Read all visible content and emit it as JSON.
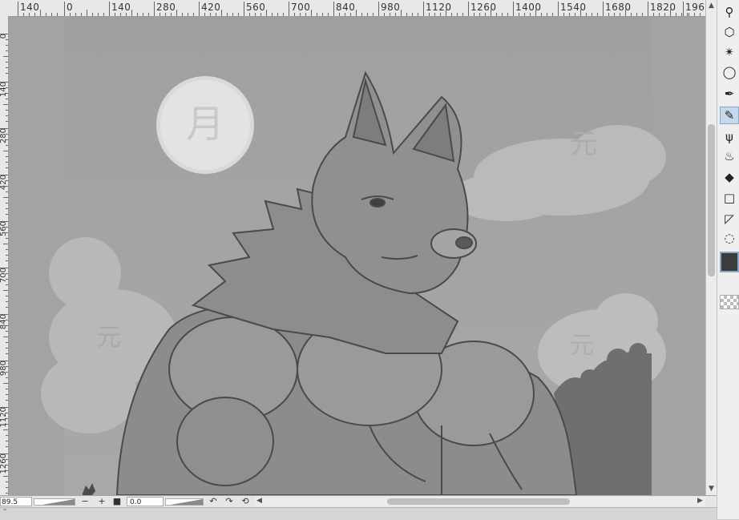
{
  "ruler": {
    "top_labels": [
      "140",
      "0",
      "140",
      "280",
      "420",
      "560",
      "700",
      "840",
      "980",
      "1120",
      "1260",
      "1400",
      "1540",
      "1680",
      "1820",
      "196"
    ],
    "left_labels": [
      "0",
      "140",
      "280",
      "420",
      "560",
      "700",
      "840",
      "980",
      "1120",
      "1260"
    ]
  },
  "canvas": {
    "moon_glyph": "月",
    "cloud_glyphs": [
      "元",
      "元",
      "元"
    ]
  },
  "tools": [
    {
      "name": "zoom-tool",
      "icon": "magnifier-icon",
      "glyph": "⚲"
    },
    {
      "name": "object-tool",
      "icon": "object-select-icon",
      "glyph": "⬡"
    },
    {
      "name": "auto-select-tool",
      "icon": "magic-wand-icon",
      "glyph": "✴"
    },
    {
      "name": "lasso-tool",
      "icon": "lasso-icon",
      "glyph": "◯"
    },
    {
      "name": "pen-tool",
      "icon": "pen-icon",
      "glyph": "✒"
    },
    {
      "name": "pencil-tool",
      "icon": "pencil-icon",
      "glyph": "✎",
      "active": true
    },
    {
      "name": "brush-tool",
      "icon": "grass-brush-icon",
      "glyph": "ψ"
    },
    {
      "name": "blend-tool",
      "icon": "blend-drops-icon",
      "glyph": "♨"
    },
    {
      "name": "fill-tool",
      "icon": "paint-bucket-icon",
      "glyph": "◆"
    },
    {
      "name": "figure-tool",
      "icon": "rectangle-icon",
      "glyph": "□"
    },
    {
      "name": "frame-tool",
      "icon": "frame-border-icon",
      "glyph": "◸"
    },
    {
      "name": "balloon-tool",
      "icon": "speech-balloon-icon",
      "glyph": "◌"
    }
  ],
  "colors": {
    "main_color": "#3c3c3c",
    "accent": "#8aa6c9"
  },
  "status": {
    "zoom": "89.5",
    "minus_label": "−",
    "plus_label": "+",
    "stop_label": "■",
    "angle": "0.0",
    "undo_label": "↶",
    "redo_label": "↷",
    "reset_label": "⟲"
  }
}
